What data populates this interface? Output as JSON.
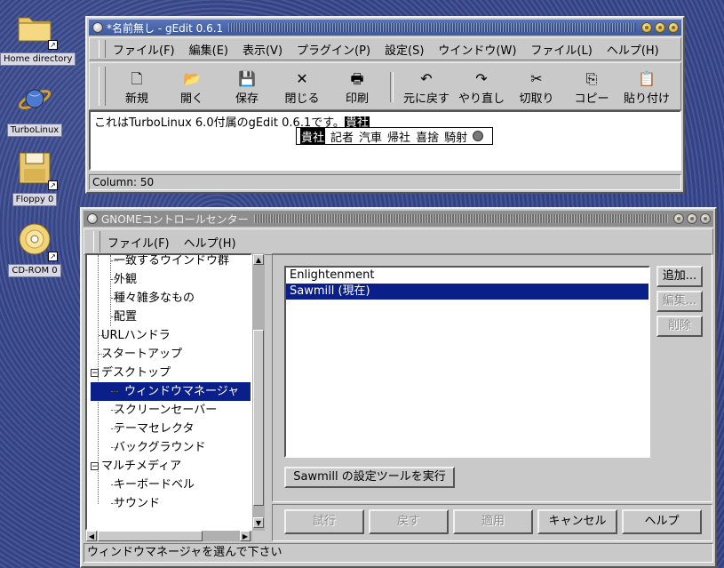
{
  "desktop": {
    "icons": [
      {
        "label": "Home directory"
      },
      {
        "label": "TurboLinux"
      },
      {
        "label": "Floppy 0"
      },
      {
        "label": "CD-ROM 0"
      }
    ]
  },
  "gedit": {
    "title": "*名前無し - gEdit 0.6.1",
    "menu": [
      "ファイル(F)",
      "編集(E)",
      "表示(V)",
      "プラグイン(P)",
      "設定(S)",
      "ウインドウ(W)",
      "ファイル(L)",
      "ヘルプ(H)"
    ],
    "toolbar": [
      {
        "label": "新規",
        "icon": "new-file-icon",
        "glyph": "🗋"
      },
      {
        "label": "開く",
        "icon": "open-folder-icon",
        "glyph": "📂"
      },
      {
        "label": "保存",
        "icon": "save-disk-icon",
        "glyph": "💾"
      },
      {
        "label": "閉じる",
        "icon": "close-x-icon",
        "glyph": "✕"
      },
      {
        "label": "印刷",
        "icon": "printer-icon",
        "glyph": "🖶"
      },
      {
        "label": "元に戻す",
        "icon": "undo-icon",
        "glyph": "↶"
      },
      {
        "label": "やり直し",
        "icon": "redo-icon",
        "glyph": "↷"
      },
      {
        "label": "切取り",
        "icon": "scissors-icon",
        "glyph": "✂"
      },
      {
        "label": "コピー",
        "icon": "copy-icon",
        "glyph": "⎘"
      },
      {
        "label": "貼り付け",
        "icon": "paste-icon",
        "glyph": "📋"
      }
    ],
    "text": "これはTurboLinux 6.0付属のgEdit 0.6.1です。",
    "preedit": "貴社",
    "candidates": [
      "貴社",
      "記者",
      "汽車",
      "帰社",
      "喜捨",
      "騎射"
    ],
    "status": "Column: 50"
  },
  "control_center": {
    "title": "GNOMEコントロールセンター",
    "menu": [
      "ファイル(F)",
      "ヘルプ(H)"
    ],
    "tree": [
      {
        "label": "一致するウインドウ群",
        "level": 2
      },
      {
        "label": "外観",
        "level": 2
      },
      {
        "label": "種々雑多なもの",
        "level": 2
      },
      {
        "label": "配置",
        "level": 2
      },
      {
        "label": "URLハンドラ",
        "level": 1
      },
      {
        "label": "スタートアップ",
        "level": 1
      },
      {
        "label": "デスクトップ",
        "level": 0,
        "expander": "−"
      },
      {
        "label": "ウィンドウマネージャ",
        "level": 2,
        "selected": true
      },
      {
        "label": "スクリーンセーバー",
        "level": 2
      },
      {
        "label": "テーマセレクタ",
        "level": 2
      },
      {
        "label": "バックグラウンド",
        "level": 2
      },
      {
        "label": "マルチメディア",
        "level": 0,
        "expander": "−"
      },
      {
        "label": "キーボードベル",
        "level": 2
      },
      {
        "label": "サウンド",
        "level": 2
      }
    ],
    "wm_list": [
      {
        "label": "Enlightenment",
        "selected": false
      },
      {
        "label": "Sawmill (現在)",
        "selected": true
      }
    ],
    "side_buttons": {
      "add": "追加...",
      "edit": "編集...",
      "delete": "削除"
    },
    "run_config": "Sawmill の設定ツールを実行",
    "bottom_buttons": {
      "try": "試行",
      "revert": "戻す",
      "apply": "適用",
      "cancel": "キャンセル",
      "help": "ヘルプ"
    },
    "status": "ウィンドウマネージャを選んで下さい"
  }
}
